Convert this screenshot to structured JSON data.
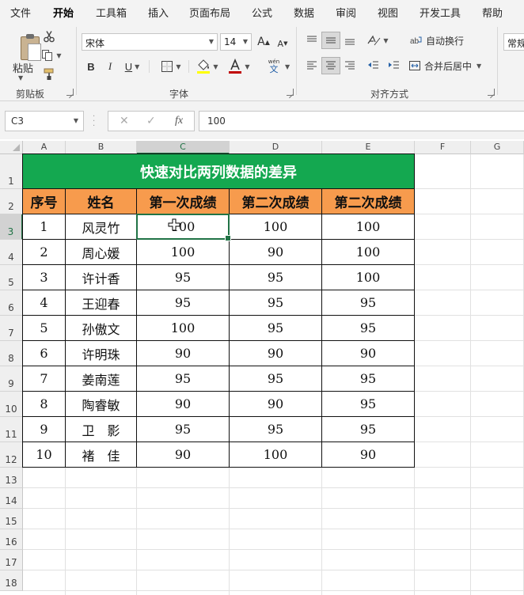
{
  "menu": {
    "tabs": [
      "文件",
      "开始",
      "工具箱",
      "插入",
      "页面布局",
      "公式",
      "数据",
      "审阅",
      "视图",
      "开发工具",
      "帮助"
    ],
    "active": "开始"
  },
  "ribbon": {
    "clipboard": {
      "paste_label": "粘贴",
      "group_label": "剪贴板"
    },
    "font": {
      "name": "宋体",
      "size": "14",
      "group_label": "字体",
      "bold": "B",
      "italic": "I",
      "underline": "U",
      "grow": "A",
      "shrink": "A",
      "phonetic_top": "wén",
      "phonetic_bottom": "文"
    },
    "alignment": {
      "wrap_label": "自动换行",
      "merge_label": "合并后居中",
      "group_label": "对齐方式"
    },
    "number": {
      "format": "常规"
    }
  },
  "formula_bar": {
    "name_box": "C3",
    "fx": "fx",
    "value": "100"
  },
  "grid": {
    "columns": [
      "A",
      "B",
      "C",
      "D",
      "E",
      "F",
      "G"
    ],
    "rows": [
      "1",
      "2",
      "3",
      "4",
      "5",
      "6",
      "7",
      "8",
      "9",
      "10",
      "11",
      "12",
      "13",
      "14",
      "15",
      "16",
      "17",
      "18"
    ],
    "title": "快速对比两列数据的差异",
    "headers": [
      "序号",
      "姓名",
      "第一次成绩",
      "第二次成绩",
      "第二次成绩"
    ],
    "records": [
      [
        "1",
        "风灵竹",
        "100",
        "100",
        "100"
      ],
      [
        "2",
        "周心媛",
        "100",
        "90",
        "100"
      ],
      [
        "3",
        "许计香",
        "95",
        "95",
        "100"
      ],
      [
        "4",
        "王迎春",
        "95",
        "95",
        "95"
      ],
      [
        "5",
        "孙傲文",
        "100",
        "95",
        "95"
      ],
      [
        "6",
        "许明珠",
        "90",
        "90",
        "90"
      ],
      [
        "7",
        "姜南莲",
        "95",
        "95",
        "95"
      ],
      [
        "8",
        "陶睿敏",
        "90",
        "90",
        "95"
      ],
      [
        "9",
        "卫　影",
        "95",
        "95",
        "95"
      ],
      [
        "10",
        "褚　佳",
        "90",
        "100",
        "90"
      ]
    ],
    "active_cell": "C3"
  },
  "colors": {
    "accent": "#217346",
    "title_fill": "#14a850",
    "header_fill": "#f79b4d"
  }
}
